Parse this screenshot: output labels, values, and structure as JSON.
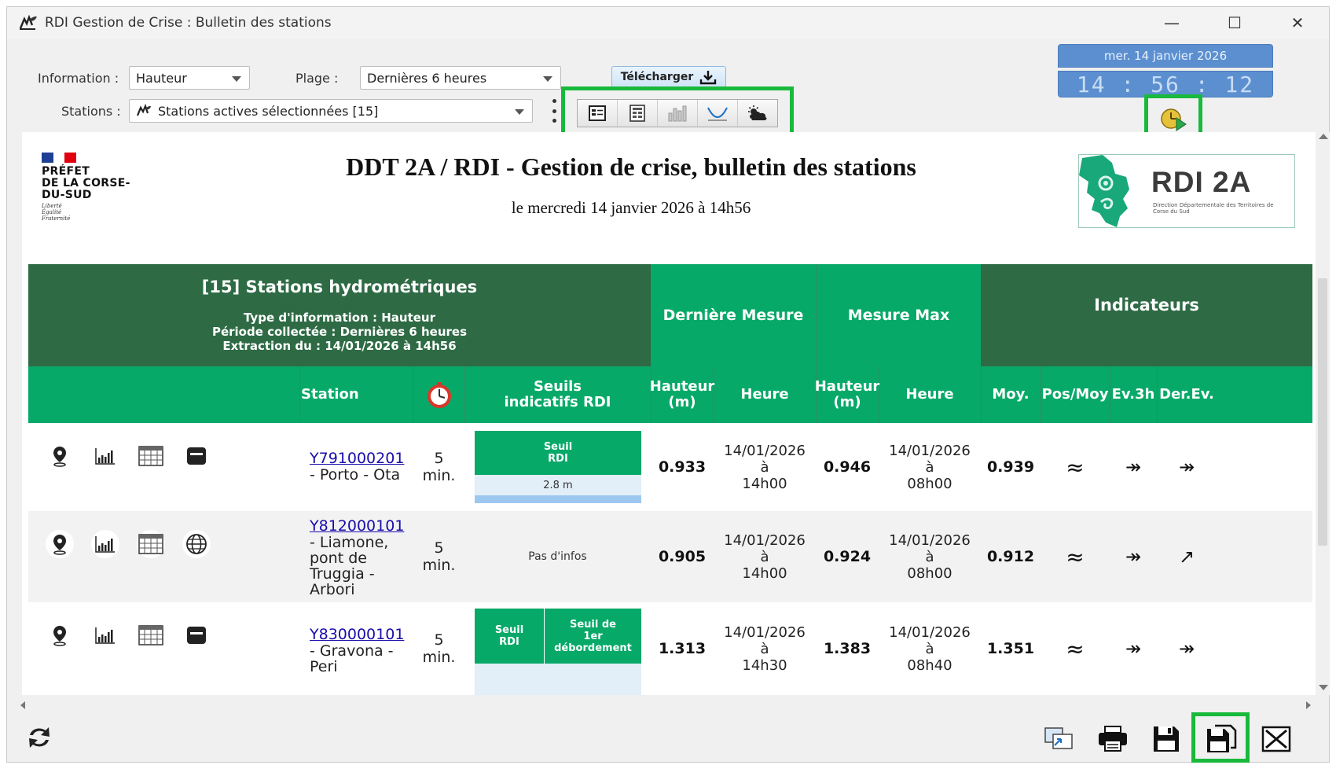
{
  "window": {
    "title": "RDI Gestion de Crise : Bulletin des stations",
    "minimize_glyph": "—",
    "maximize_glyph": "☐",
    "close_glyph": "✕"
  },
  "toolbar": {
    "information_label": "Information :",
    "information_value": "Hauteur",
    "plage_label": "Plage :",
    "plage_value": "Dernières 6 heures",
    "stations_label": "Stations :",
    "stations_value": "Stations actives sélectionnées [15]",
    "download_label": "Télécharger",
    "view_buttons": [
      "form-view-icon",
      "list-view-icon",
      "bar-chart-icon",
      "curve-icon",
      "weather-icon"
    ]
  },
  "clock": {
    "date": "mer. 14 janvier 2026",
    "time": "14 : 56 : 12"
  },
  "report": {
    "prefet_name": "PRÉFET\nDE LA CORSE-\nDU-SUD",
    "motto": "Liberté\nÉgalité\nFraternité",
    "title": "DDT 2A / RDI - Gestion de crise, bulletin des stations",
    "subtitle": "le mercredi 14 janvier 2026 à 14h56",
    "logo_text": "RDI 2A",
    "logo_sub": "Direction Départementale des Territoires de Corse du Sud"
  },
  "table": {
    "group_title": "[15] Stations hydrométriques",
    "group_meta": [
      "Type d'information : Hauteur",
      "Période collectée : Dernières 6 heures",
      "Extraction du : 14/01/2026 à 14h56"
    ],
    "derniere_mesure": "Dernière Mesure",
    "mesure_max": "Mesure Max",
    "indicateurs": "Indicateurs",
    "columns": {
      "station": "Station",
      "seuils": "Seuils\nindicatifs RDI",
      "hauteur1": "Hauteur\n(m)",
      "heure1": "Heure",
      "hauteur2": "Hauteur\n(m)",
      "heure2": "Heure",
      "moy": "Moy.",
      "posmoy": "Pos/Moy",
      "ev3h": "Ev.3h",
      "derev": "Der.Ev."
    },
    "rows": [
      {
        "code": "Y791000201",
        "name": "- Porto - Ota",
        "freq": "5\nmin.",
        "seuil_label": "Seuil\nRDI",
        "seuil_value": "2.8 m",
        "last_h": "0.933",
        "last_t": "14/01/2026\nà\n14h00",
        "max_h": "0.946",
        "max_t": "14/01/2026\nà\n08h00",
        "moy": "0.939",
        "posmoy": "≈",
        "ev3h": "↠",
        "derev": "↠"
      },
      {
        "code": "Y812000101",
        "name": "- Liamone,\npont de\nTruggia -\nArbori",
        "freq": "5\nmin.",
        "seuil_info": "Pas d'infos",
        "last_h": "0.905",
        "last_t": "14/01/2026\nà\n14h00",
        "max_h": "0.924",
        "max_t": "14/01/2026\nà\n08h00",
        "moy": "0.912",
        "posmoy": "≈",
        "ev3h": "↠",
        "derev": "↗"
      },
      {
        "code": "Y830000101",
        "name": "- Gravona -\nPeri",
        "freq": "5\nmin.",
        "seuil_label": "Seuil\nRDI",
        "seuil_label2": "Seuil de\n1er\ndébordement",
        "last_h": "1.313",
        "last_t": "14/01/2026\nà\n14h30",
        "max_h": "1.383",
        "max_t": "14/01/2026\nà\n08h40",
        "moy": "1.351",
        "posmoy": "≈",
        "ev3h": "↠",
        "derev": "↠"
      }
    ]
  },
  "colors": {
    "dark_green": "#2e6b45",
    "green": "#07a968",
    "highlight": "#19b93c",
    "clock_blue": "#5b8fd0"
  }
}
